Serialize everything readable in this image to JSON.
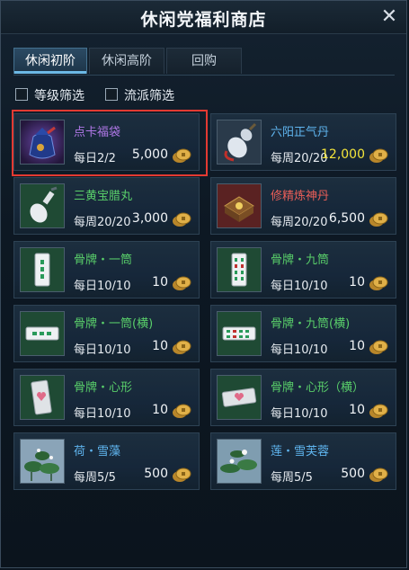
{
  "window": {
    "title": "休闲党福利商店",
    "close_symbol": "✕"
  },
  "tabs": [
    {
      "label": "休闲初阶",
      "active": true
    },
    {
      "label": "休闲高阶",
      "active": false
    },
    {
      "label": "回购",
      "active": false
    }
  ],
  "filters": [
    {
      "label": "等级筛选",
      "checked": false
    },
    {
      "label": "流派筛选",
      "checked": false
    }
  ],
  "items": [
    {
      "name": "点卡福袋",
      "limit": "每日2/2",
      "price": "5,000",
      "name_color": "purple",
      "icon": "lucky-bag-icon",
      "highlighted": true
    },
    {
      "name": "六阳正气丹",
      "limit": "每周20/20",
      "price": "12,000",
      "name_color": "blue",
      "price_color": "#f3e53a",
      "icon": "gourd-pill-icon"
    },
    {
      "name": "三黄宝腊丸",
      "limit": "每周20/20",
      "price": "3,000",
      "name_color": "green",
      "icon": "medicine-bottle-icon"
    },
    {
      "name": "修精炼神丹",
      "limit": "每周20/20",
      "price": "6,500",
      "name_color": "red",
      "icon": "pill-box-icon"
    },
    {
      "name": "骨牌・一筒",
      "limit": "每日10/10",
      "price": "10",
      "name_color": "green",
      "icon": "domino-one-icon"
    },
    {
      "name": "骨牌・九筒",
      "limit": "每日10/10",
      "price": "10",
      "name_color": "green",
      "icon": "domino-nine-icon"
    },
    {
      "name": "骨牌・一筒(横)",
      "limit": "每日10/10",
      "price": "10",
      "name_color": "green",
      "icon": "domino-one-horizontal-icon"
    },
    {
      "name": "骨牌・九筒(横)",
      "limit": "每日10/10",
      "price": "10",
      "name_color": "green",
      "icon": "domino-nine-horizontal-icon"
    },
    {
      "name": "骨牌・心形",
      "limit": "每日10/10",
      "price": "10",
      "name_color": "green",
      "icon": "domino-heart-icon"
    },
    {
      "name": "骨牌・心形（横）",
      "limit": "每日10/10",
      "price": "10",
      "name_color": "green",
      "icon": "domino-heart-horizontal-icon"
    },
    {
      "name": "荷・雪藻",
      "limit": "每周5/5",
      "price": "500",
      "name_color": "blue",
      "icon": "lotus-leaf-icon"
    },
    {
      "name": "莲・雪芙蓉",
      "limit": "每周5/5",
      "price": "500",
      "name_color": "blue",
      "icon": "lotus-flower-icon"
    }
  ],
  "currency_icon": "gold-coin-icon",
  "colors": {
    "accent": "#6cb9e6",
    "highlight": "#e33a32"
  }
}
